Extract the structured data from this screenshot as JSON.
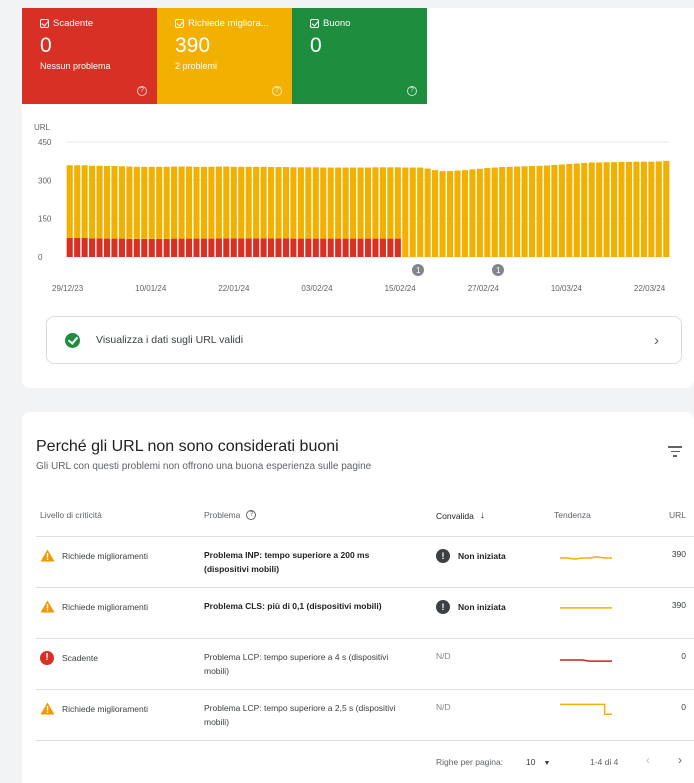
{
  "tiles": [
    {
      "label": "Scadente",
      "value": "0",
      "sub": "Nessun problema",
      "color": "#d93025"
    },
    {
      "label": "Richiede migliora...",
      "value": "390",
      "sub": "2 problemi",
      "color": "#f2b100"
    },
    {
      "label": "Buono",
      "value": "0",
      "sub": "",
      "color": "#1e8e3e"
    }
  ],
  "chart_data": {
    "type": "bar",
    "stacked": true,
    "ylabel": "URL",
    "yticks": [
      0,
      150,
      300,
      450
    ],
    "ylim": [
      0,
      450
    ],
    "xticks": [
      "29/12/23",
      "10/01/24",
      "22/01/24",
      "03/02/24",
      "15/02/24",
      "27/02/24",
      "10/03/24",
      "22/03/24"
    ],
    "annotations": [
      "1",
      "1"
    ],
    "series": [
      {
        "color": "#d93025",
        "values": [
          75,
          75,
          75,
          73,
          73,
          72,
          72,
          72,
          71,
          71,
          71,
          71,
          71,
          71,
          72,
          72,
          72,
          72,
          72,
          72,
          73,
          73,
          73,
          73,
          73,
          73,
          73,
          73,
          73,
          73,
          72,
          72,
          72,
          72,
          72,
          72,
          72,
          72,
          72,
          72,
          72,
          72,
          72,
          72,
          72,
          0,
          0,
          0,
          0,
          0,
          0,
          0,
          0,
          0,
          0,
          0,
          0,
          0,
          0,
          0,
          0,
          0,
          0,
          0,
          0,
          0,
          0,
          0,
          0,
          0,
          0,
          0,
          0,
          0,
          0,
          0,
          0,
          0,
          0,
          0,
          0
        ]
      },
      {
        "color": "#f2b100",
        "values": [
          284,
          284,
          284,
          284,
          284,
          284,
          284,
          283,
          283,
          282,
          282,
          282,
          282,
          282,
          282,
          282,
          282,
          281,
          281,
          281,
          281,
          281,
          280,
          280,
          280,
          280,
          280,
          279,
          279,
          279,
          279,
          279,
          279,
          279,
          278,
          278,
          278,
          278,
          278,
          278,
          278,
          279,
          279,
          279,
          279,
          350,
          350,
          350,
          346,
          340,
          336,
          336,
          338,
          340,
          343,
          345,
          348,
          350,
          352,
          353,
          354,
          355,
          356,
          357,
          358,
          360,
          362,
          364,
          366,
          368,
          370,
          370,
          371,
          371,
          372,
          372,
          373,
          373,
          373,
          374,
          376
        ]
      }
    ]
  },
  "valid_link": {
    "label": "Visualizza i dati sugli URL validi"
  },
  "issues": {
    "title": "Perché gli URL non sono considerati buoni",
    "subtitle": "Gli URL con questi problemi non offrono una buona esperienza sulle pagine",
    "columns": {
      "severity": "Livello di criticità",
      "problem": "Problema",
      "validation": "Convalida",
      "trend": "Tendenza",
      "urls": "URL"
    },
    "rows": [
      {
        "severity": "Richiede miglioramenti",
        "type": "warn",
        "problem": "Problema INP: tempo superiore a 200 ms (dispositivi mobili)",
        "bold": true,
        "validation": "Non iniziata",
        "urls": "390",
        "trend_color": "#f2b100",
        "trend": [
          0.5,
          0.5,
          0.55,
          0.5,
          0.5,
          0.45,
          0.5,
          0.5
        ]
      },
      {
        "severity": "Richiede miglioramenti",
        "type": "warn",
        "problem": "Problema CLS: più di 0,1 (dispositivi mobili)",
        "bold": true,
        "validation": "Non iniziata",
        "urls": "390",
        "trend_color": "#f2b100",
        "trend": [
          0.45,
          0.45,
          0.45,
          0.45,
          0.45,
          0.45,
          0.45,
          0.45
        ]
      },
      {
        "severity": "Scadente",
        "type": "err",
        "problem": "Problema LCP: tempo superiore a 4 s (dispositivi mobili)",
        "bold": false,
        "validation": "N/D",
        "urls": "0",
        "trend_color": "#c5221f",
        "trend": [
          0.5,
          0.5,
          0.5,
          0.5,
          0.55,
          0.55,
          0.55,
          0.55
        ]
      },
      {
        "severity": "Richiede miglioramenti",
        "type": "warn",
        "problem": "Problema LCP: tempo superiore a 2,5 s (dispositivi mobili)",
        "bold": false,
        "validation": "N/D",
        "urls": "0",
        "trend_color": "#f2b100",
        "trend": [
          0.2,
          0.2,
          0.2,
          0.2,
          0.2,
          0.2,
          0.65,
          0.65
        ]
      }
    ],
    "pager": {
      "rows_label": "Righe per pagina:",
      "rows_value": "10",
      "range": "1-4 di 4"
    }
  }
}
